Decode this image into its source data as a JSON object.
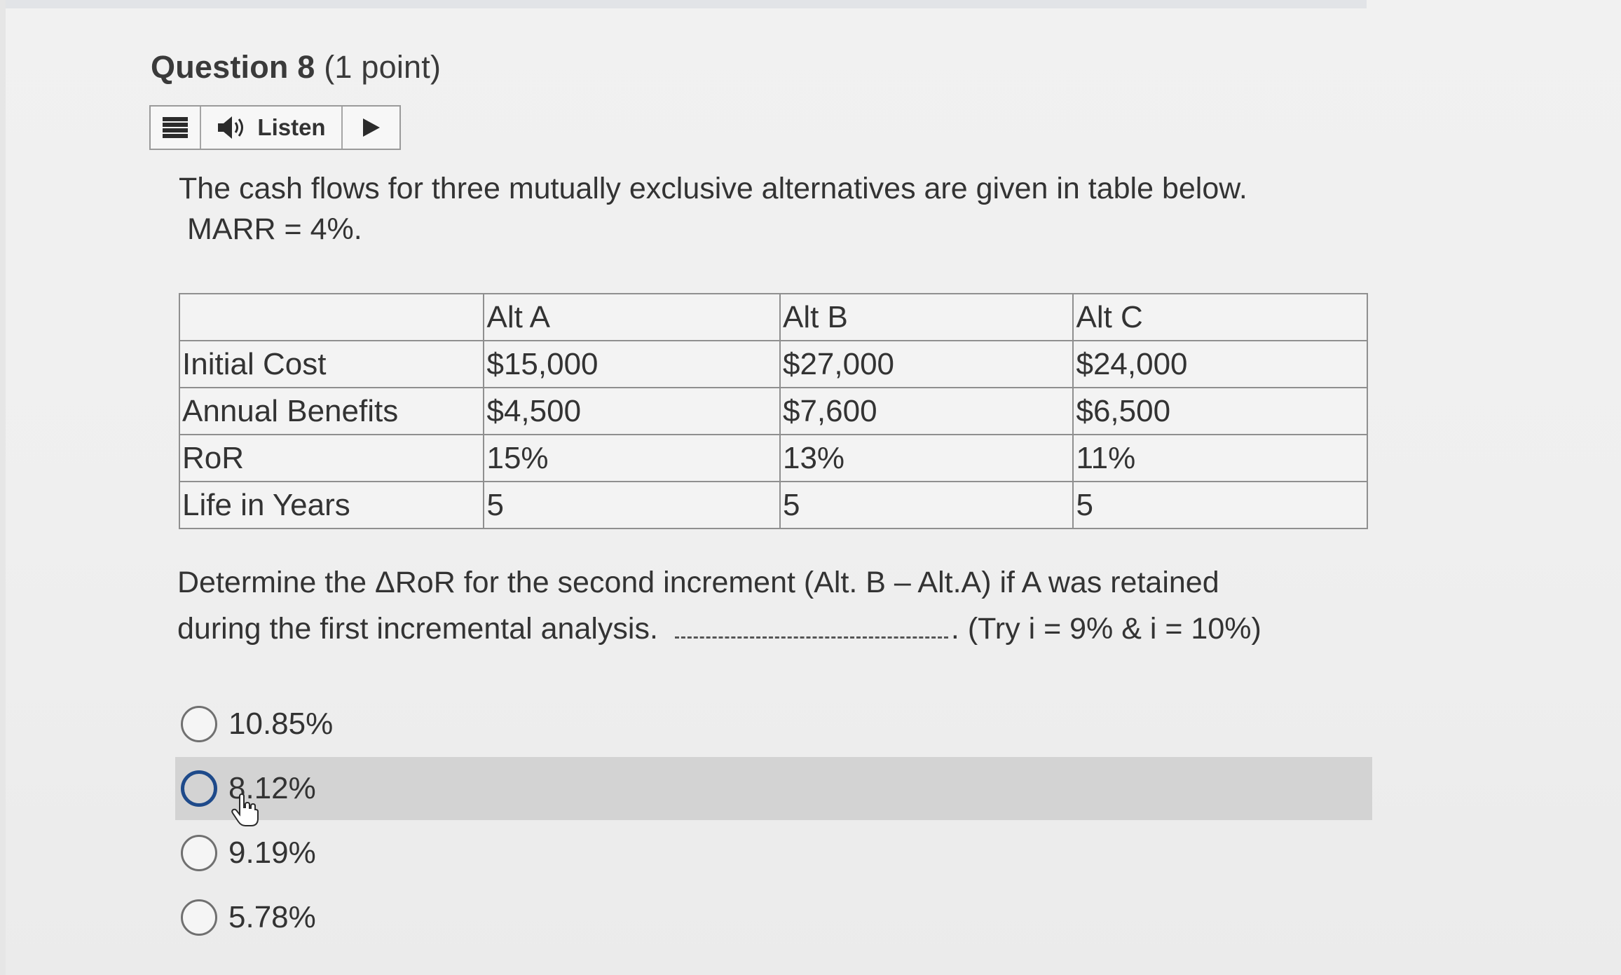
{
  "question": {
    "number": "Question 8",
    "points": "(1 point)"
  },
  "listen_bar": {
    "menu_icon": "menu-icon",
    "speaker_icon": "speaker-icon",
    "label": "Listen",
    "play_icon": "play-icon"
  },
  "prompt": {
    "line1": "The cash flows for three mutually exclusive alternatives are given in table below.",
    "line2": "MARR = 4%."
  },
  "table": {
    "headers": [
      "",
      "Alt A",
      "Alt B",
      "Alt C"
    ],
    "rows": [
      [
        "Initial Cost",
        "$15,000",
        "$27,000",
        "$24,000"
      ],
      [
        "Annual Benefits",
        "$4,500",
        "$7,600",
        "$6,500"
      ],
      [
        "RoR",
        "15%",
        "13%",
        "11%"
      ],
      [
        "Life in Years",
        "5",
        "5",
        "5"
      ]
    ]
  },
  "incremental_question": {
    "line1": "Determine the ΔRoR for the second increment (Alt. B – Alt.A) if A was retained",
    "line2_before": "during the first incremental analysis.",
    "line2_after": ". (Try i = 9% & i = 10%)"
  },
  "options": [
    {
      "label": "10.85%",
      "hovered": false
    },
    {
      "label": "8.12%",
      "hovered": true
    },
    {
      "label": "9.19%",
      "hovered": false
    },
    {
      "label": "5.78%",
      "hovered": false
    }
  ],
  "colors": {
    "hover_row": "#d3d3d3",
    "focus_ring": "#1e4a8a",
    "text": "#333333"
  },
  "cursor_icon": "hand-pointer-icon"
}
